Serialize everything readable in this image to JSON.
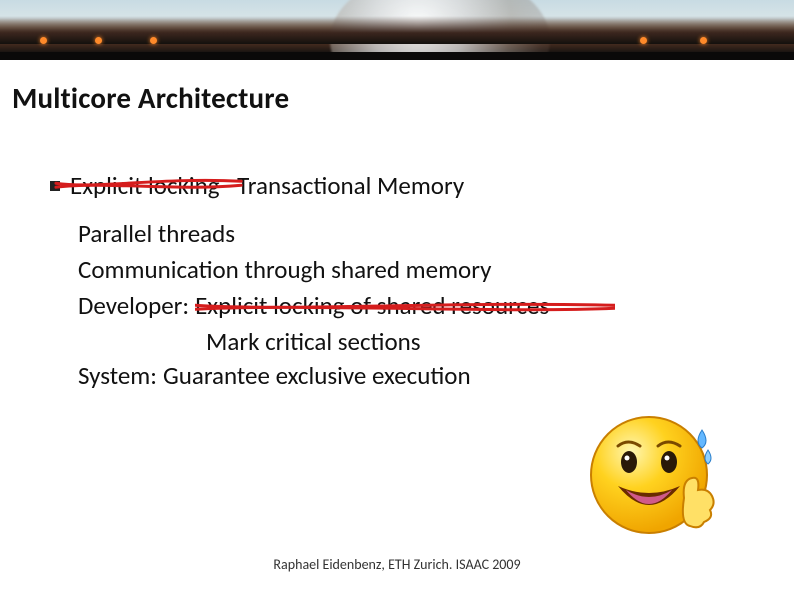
{
  "title": "Multicore Architecture",
  "bullet": {
    "label_struck": "Explicit locking",
    "label_replacement": "Transactional Memory"
  },
  "lines": {
    "l1": "Parallel threads",
    "l2": "Communication through shared memory",
    "dev_prefix": "Developer:",
    "dev_struck": "Explicit locking of shared resources",
    "dev_replacement": "Mark critical sections",
    "sys_prefix": "System:",
    "sys_text": "Guarantee exclusive execution"
  },
  "footer": "Raphael Eidenbenz, ETH Zurich. ISAAC 2009",
  "icons": {
    "bullet_square": "bullet-square-icon",
    "smiley": "smiley-thumbs-up-icon"
  },
  "colors": {
    "strike": "#d51d1d",
    "smiley_body": "#ffd21f",
    "smiley_shadow": "#e89a00"
  }
}
